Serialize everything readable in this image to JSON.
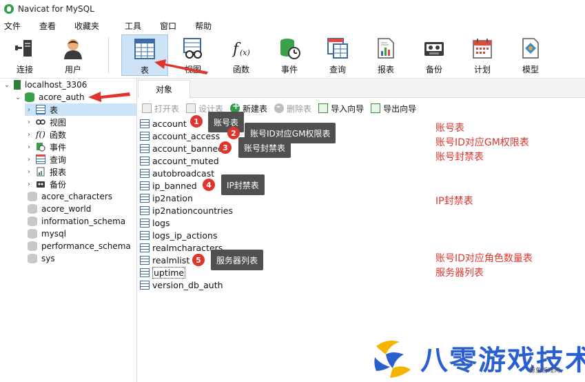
{
  "window": {
    "title": "Navicat for MySQL"
  },
  "menu": [
    "文件",
    "查看",
    "收藏夹",
    "工具",
    "窗口",
    "帮助"
  ],
  "toolbar": [
    {
      "label": "连接",
      "icon": "connection-icon"
    },
    {
      "label": "用户",
      "icon": "user-icon"
    },
    {
      "label": "表",
      "icon": "table-icon",
      "active": true
    },
    {
      "label": "视图",
      "icon": "view-icon"
    },
    {
      "label": "函数",
      "icon": "function-icon"
    },
    {
      "label": "事件",
      "icon": "event-icon"
    },
    {
      "label": "查询",
      "icon": "query-icon"
    },
    {
      "label": "报表",
      "icon": "report-icon"
    },
    {
      "label": "备份",
      "icon": "backup-icon"
    },
    {
      "label": "计划",
      "icon": "schedule-icon"
    },
    {
      "label": "模型",
      "icon": "model-icon"
    }
  ],
  "sidebar": {
    "connection": "localhost_3306",
    "active_db": "acore_auth",
    "db_children": [
      "表",
      "视图",
      "函数",
      "事件",
      "查询",
      "报表",
      "备份"
    ],
    "other_dbs": [
      "acore_characters",
      "acore_world",
      "information_schema",
      "mysql",
      "performance_schema",
      "sys"
    ]
  },
  "tab": {
    "label": "对象"
  },
  "object_toolbar": {
    "open": "打开表",
    "design": "设计表",
    "new": "新建表",
    "delete": "删除表",
    "import": "导入向导",
    "export": "导出向导"
  },
  "tables": [
    "account",
    "account_access",
    "account_banned",
    "account_muted",
    "autobroadcast",
    "ip_banned",
    "ip2nation",
    "ip2nationcountries",
    "logs",
    "logs_ip_actions",
    "realmcharacters",
    "realmlist",
    "uptime",
    "version_db_auth"
  ],
  "annotations": {
    "badges": [
      "1",
      "2",
      "3",
      "4",
      "5"
    ],
    "callouts": [
      "账号表",
      "账号ID对应GM权限表",
      "账号封禁表",
      "IP封禁表",
      "服务器列表"
    ],
    "notes": [
      "账号表",
      "账号ID对应GM权限表",
      "账号封禁表",
      "IP封禁表",
      "账号ID对应角色数量表",
      "服务器列表"
    ]
  },
  "watermark": {
    "text": "八零游戏技术",
    "small": "鲸鱼游戏网"
  },
  "colors": {
    "accent_red": "#e0342c",
    "selection": "#cfe3f7",
    "watermark_blue": "#2a5fd0"
  }
}
